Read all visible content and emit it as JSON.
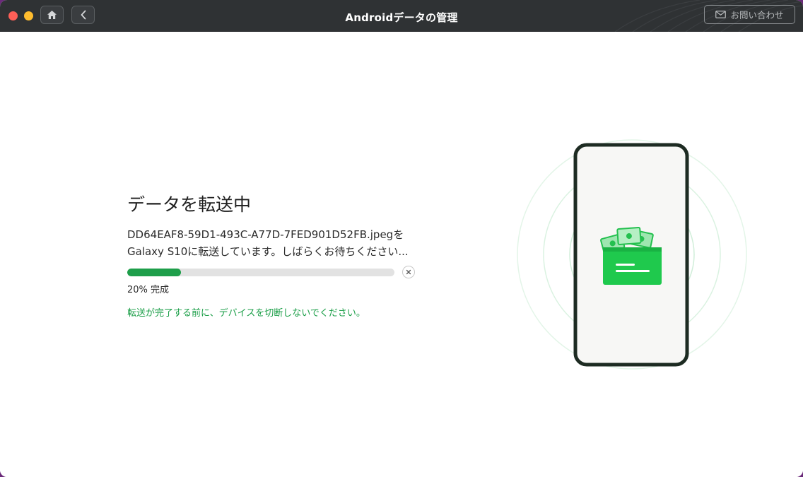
{
  "titlebar": {
    "title": "Androidデータの管理",
    "contact_label": "お問い合わせ"
  },
  "transfer": {
    "title": "データを転送中",
    "message_line1": "DD64EAF8-59D1-493C-A77D-7FED901D52FB.jpegを",
    "message_line2": "Galaxy S10に転送しています。しばらくお待ちください...",
    "progress_percent": 20,
    "progress_label": "20% 完成",
    "warning": "転送が完了する前に、デバイスを切断しないでください。"
  },
  "icons": {
    "home": "home-icon",
    "back": "chevron-left-icon",
    "mail": "mail-icon",
    "cancel": "close-icon",
    "illustration": "phone-wallet-icon"
  },
  "colors": {
    "accent": "#1e9e4a",
    "titlebar": "#2f3234",
    "progress_track": "#e2e2e2",
    "warning": "#1a9e47"
  }
}
